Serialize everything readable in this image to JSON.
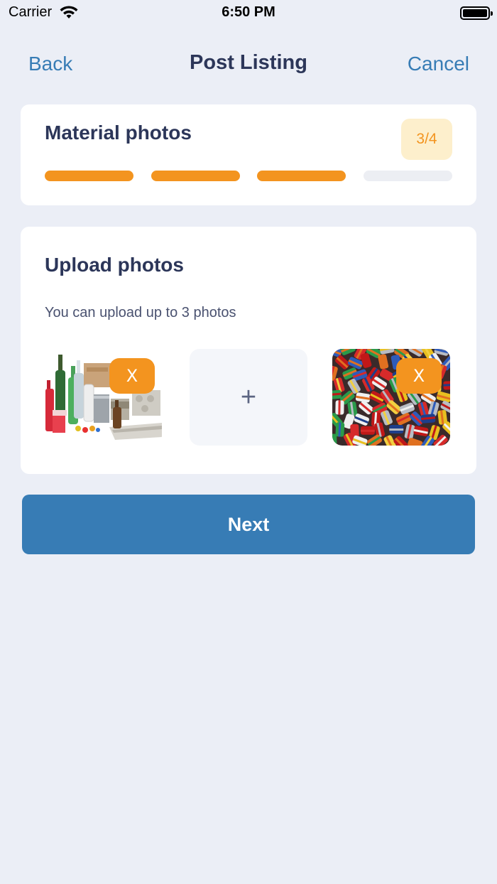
{
  "status_bar": {
    "carrier": "Carrier",
    "time": "6:50 PM",
    "icons": [
      "wifi-icon",
      "battery-icon"
    ]
  },
  "nav": {
    "back_label": "Back",
    "title": "Post Listing",
    "cancel_label": "Cancel"
  },
  "progress": {
    "title": "Material photos",
    "step_label": "3/4",
    "current_step": 3,
    "total_steps": 4,
    "accent_color": "#F3941F",
    "badge_color": "#FDEFCC"
  },
  "upload": {
    "title": "Upload photos",
    "hint": "You can upload up to 3 photos",
    "slots": [
      {
        "type": "photo",
        "description_icon": "recyclables-photo",
        "remove_label": "X"
      },
      {
        "type": "add",
        "add_label": "+"
      },
      {
        "type": "photo",
        "description_icon": "cans-photo",
        "remove_label": "X"
      }
    ]
  },
  "actions": {
    "next_label": "Next",
    "primary_color": "#377CB5"
  }
}
